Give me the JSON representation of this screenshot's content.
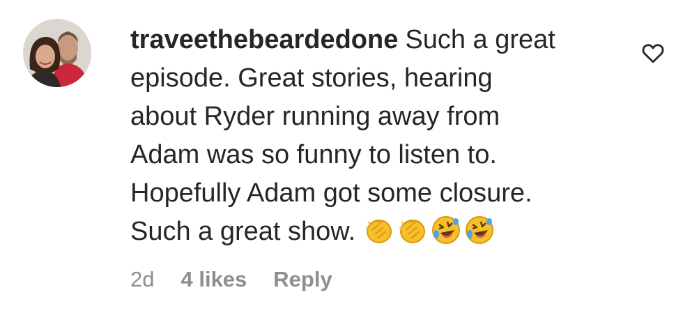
{
  "comment": {
    "username": "traveethebeardedone",
    "text_lines": [
      "Such a great",
      "episode. Great stories, hearing",
      "about Ryder running away from",
      "Adam was so funny to listen to.",
      "Hopefully Adam got some closure.",
      "Such a great show."
    ],
    "emojis": [
      "clapping-hands-icon",
      "clapping-hands-icon",
      "rolling-on-floor-laughing-icon",
      "rolling-on-floor-laughing-icon"
    ],
    "time": "2d",
    "likes": "4 likes",
    "reply_label": "Reply"
  },
  "colors": {
    "text": "#262626",
    "meta": "#8e8e8e",
    "emoji_yellow": "#f7c02a"
  }
}
